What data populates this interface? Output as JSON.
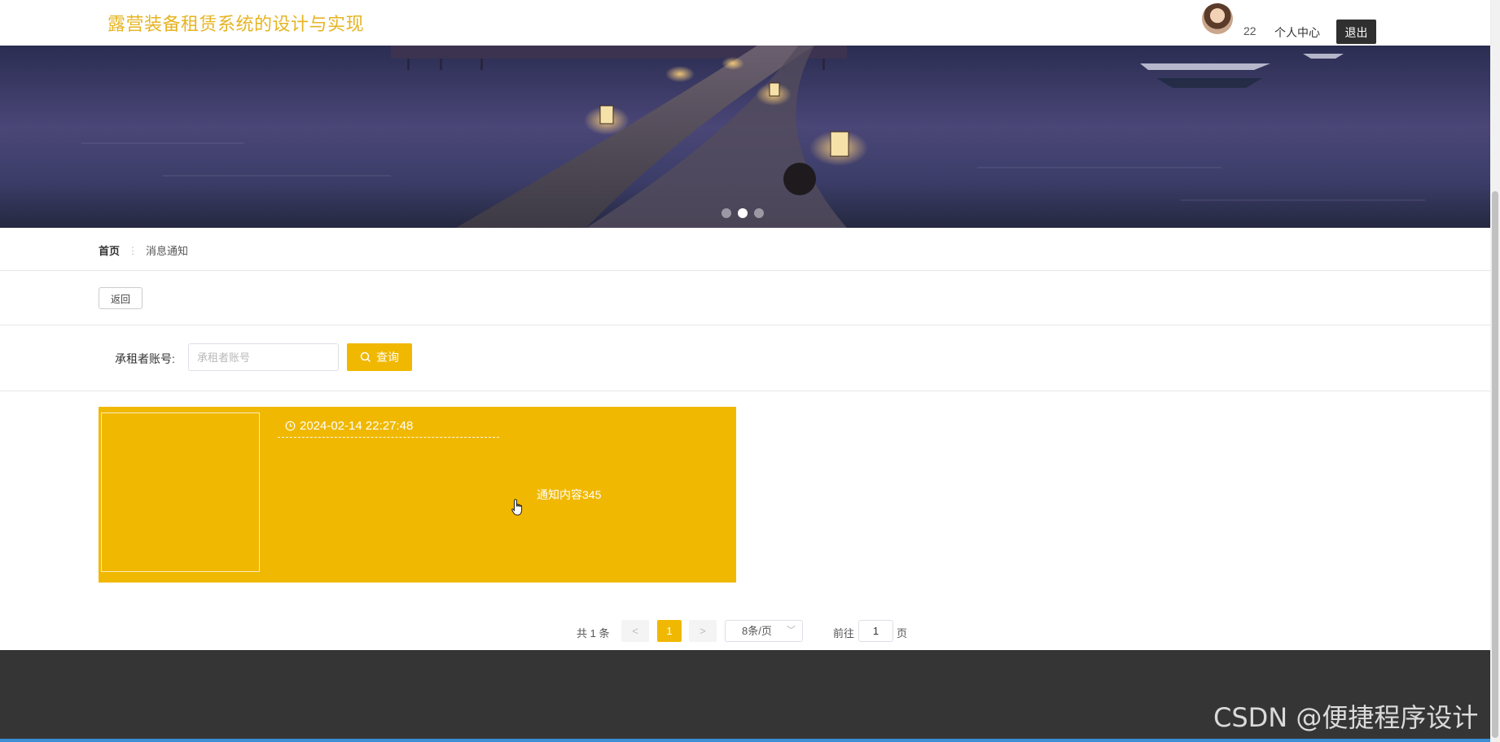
{
  "header": {
    "brand_title": "露营装备租赁系统的设计与实现",
    "user_number": "22",
    "personal_center_label": "个人中心",
    "logout_label": "退出"
  },
  "banner": {
    "slide_count": 3,
    "active_slide": 2
  },
  "breadcrumb": {
    "home": "首页",
    "separator": "⋮",
    "current": "消息通知"
  },
  "back_label": "返回",
  "search": {
    "label": "承租者账号:",
    "placeholder": "承租者账号",
    "value": "",
    "button_label": "查询"
  },
  "notices": [
    {
      "time": "2024-02-14 22:27:48",
      "content": "通知内容345"
    }
  ],
  "pagination": {
    "total_text": "共 1 条",
    "prev": "<",
    "current_page": "1",
    "next": ">",
    "page_size": "8条/页",
    "goto_label": "前往",
    "goto_value": "1",
    "page_unit": "页"
  },
  "watermark": "CSDN @便捷程序设计",
  "colors": {
    "brand": "#e6b422",
    "accent": "#f0b800",
    "footer": "#353535",
    "dark_button": "#2f2f2f"
  }
}
